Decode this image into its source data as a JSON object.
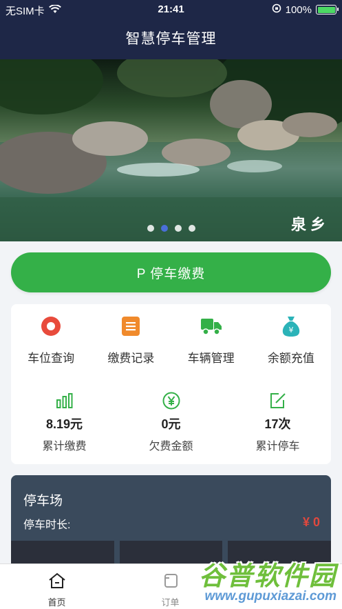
{
  "status_bar": {
    "carrier": "无SIM卡",
    "time": "21:41",
    "battery": "100%"
  },
  "header": {
    "title": "智慧停车管理"
  },
  "banner": {
    "slide_count": 4,
    "active_index": 1,
    "watermark": "泉乡"
  },
  "pay_button": {
    "label": "P 停车缴费"
  },
  "menu": [
    {
      "label": "车位查询",
      "icon": "location-icon",
      "color": "#e84b3c"
    },
    {
      "label": "缴费记录",
      "icon": "document-icon",
      "color": "#f08a2c"
    },
    {
      "label": "车辆管理",
      "icon": "truck-icon",
      "color": "#34b048"
    },
    {
      "label": "余额充值",
      "icon": "money-bag-icon",
      "color": "#2bb3b8"
    }
  ],
  "stats": [
    {
      "value": "8.19元",
      "label": "累计缴费",
      "icon": "bar-chart-icon"
    },
    {
      "value": "0元",
      "label": "欠费金额",
      "icon": "yen-circle-icon"
    },
    {
      "value": "17次",
      "label": "累计停车",
      "icon": "edit-icon"
    }
  ],
  "parking": {
    "title": "停车场",
    "duration_label": "停车时长:",
    "amount": "¥ 0"
  },
  "tabs": [
    {
      "label": "首页",
      "icon": "home-icon",
      "active": true
    },
    {
      "label": "订单",
      "icon": "order-icon",
      "active": false
    }
  ],
  "watermark_logo": {
    "name": "谷普软件园",
    "url": "www.gupuxiazai.com"
  },
  "colors": {
    "header_bg": "#1e2747",
    "accent_green": "#34b048",
    "amount_red": "#e0483e",
    "lot_bg": "#3a4a5c"
  }
}
